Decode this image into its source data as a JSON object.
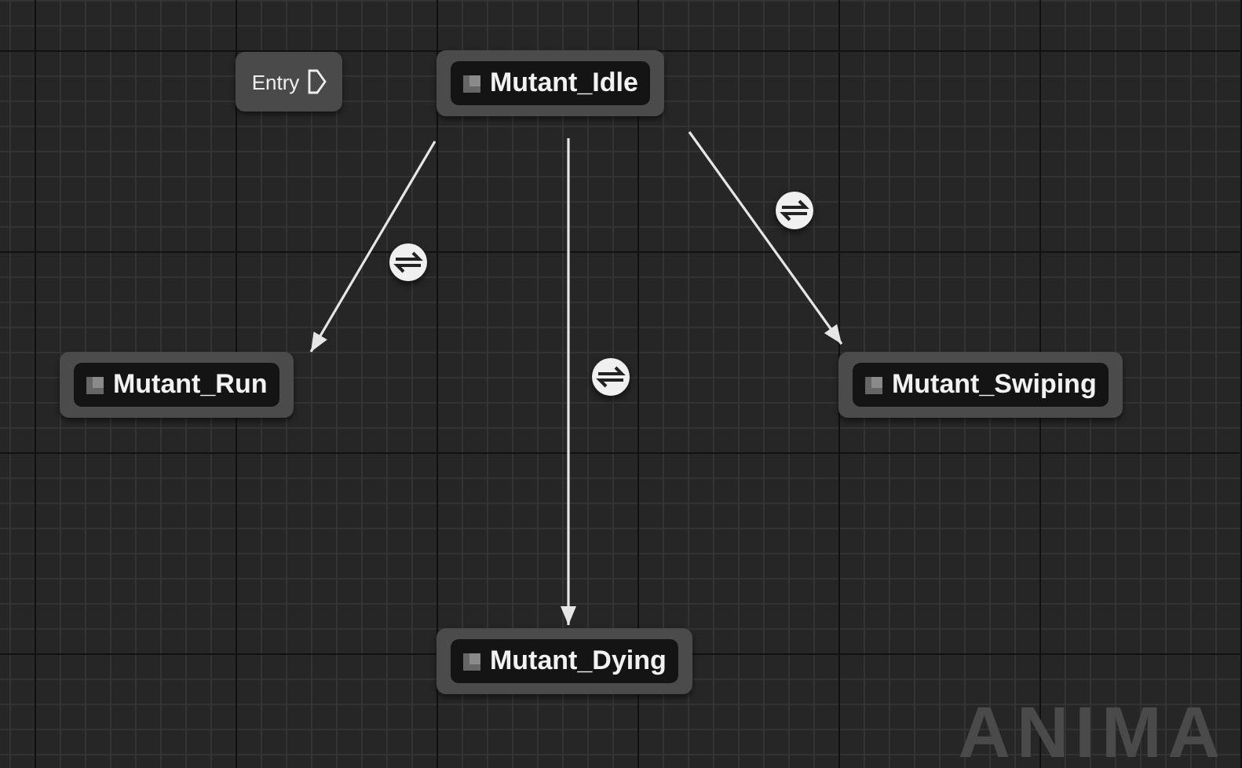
{
  "entry": {
    "label": "Entry"
  },
  "states": [
    {
      "name": "Mutant_Idle"
    },
    {
      "name": "Mutant_Run"
    },
    {
      "name": "Mutant_Swiping"
    },
    {
      "name": "Mutant_Dying"
    }
  ],
  "graph_label": "ANIMA"
}
